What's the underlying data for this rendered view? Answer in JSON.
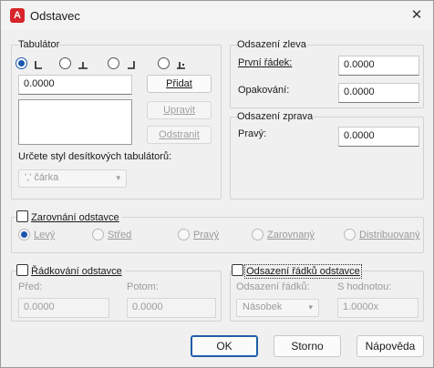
{
  "window": {
    "title": "Odstavec",
    "app_icon_letter": "A",
    "close_symbol": "✕"
  },
  "tabulator": {
    "group_label": "Tabulátor",
    "tab_value": "0.0000",
    "add_button": "Přidat",
    "modify_button": "Upravit",
    "remove_button": "Odstranit",
    "decimal_style_label": "Určete styl desítkových tabulátorů:",
    "decimal_style_value": "',' čárka"
  },
  "indent_left": {
    "group_label": "Odsazení zleva",
    "first_line_label": "První řádek:",
    "first_line_value": "0.0000",
    "hanging_label": "Opakování:",
    "hanging_value": "0.0000"
  },
  "indent_right": {
    "group_label": "Odsazení zprava",
    "right_label": "Pravý:",
    "right_value": "0.0000"
  },
  "alignment": {
    "group_label": "Zarovnání odstavce",
    "options": [
      "Levý",
      "Střed",
      "Pravý",
      "Zarovnaný",
      "Distribuovaný"
    ]
  },
  "line_spacing": {
    "group_label": "Řádkování odstavce",
    "before_label": "Před:",
    "before_value": "0.0000",
    "after_label": "Potom:",
    "after_value": "0.0000"
  },
  "paragraph_spacing": {
    "group_label": "Odsazení řádků odstavce",
    "spacing_label": "Odsazení řádků:",
    "spacing_value": "Násobek",
    "at_label": "S hodnotou:",
    "at_value": "1.0000x"
  },
  "footer": {
    "ok": "OK",
    "cancel": "Storno",
    "help": "Nápověda"
  }
}
